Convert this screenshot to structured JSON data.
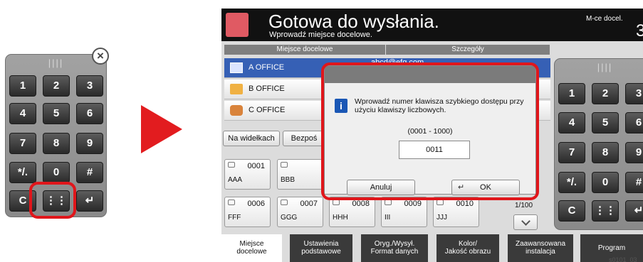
{
  "keypad": {
    "grip": "||||",
    "close_icon": "×",
    "keys": [
      "1",
      "2",
      "3",
      "4",
      "5",
      "6",
      "7",
      "8",
      "9",
      "*/.",
      "0",
      "#",
      "C",
      "⋮⋮",
      "↵"
    ]
  },
  "screen": {
    "title": "Gotowa do wysłania.",
    "subtitle": "Wprowadź miejsce docelowe.",
    "dest_label": "M-ce docel.",
    "count": "3",
    "columns": [
      "Miejsce docelowe",
      "Szczegóły"
    ],
    "rows": [
      {
        "name": "A OFFICE",
        "detail": "abcd@efg.com"
      },
      {
        "name": "B OFFICE",
        "detail": ""
      },
      {
        "name": "C OFFICE",
        "detail": ""
      }
    ],
    "buttons": {
      "hook": "Na widełkach",
      "direct": "Bezpoś"
    },
    "quick": [
      {
        "num": "0001",
        "name": "AAA"
      },
      {
        "num": "",
        "name": "BBB"
      },
      {
        "num": "0006",
        "name": "FFF"
      },
      {
        "num": "0007",
        "name": "GGG"
      },
      {
        "num": "0008",
        "name": "HHH"
      },
      {
        "num": "0009",
        "name": "III"
      },
      {
        "num": "0010",
        "name": "JJJ"
      }
    ],
    "page": "1/100",
    "tabs": [
      {
        "l1": "Miejsce",
        "l2": "docelowe"
      },
      {
        "l1": "Ustawienia",
        "l2": "podstawowe"
      },
      {
        "l1": "Oryg./Wysył.",
        "l2": "Format danych"
      },
      {
        "l1": "Kolor/",
        "l2": "Jakość obrazu"
      },
      {
        "l1": "Zaawansowana",
        "l2": "instalacja"
      },
      {
        "l1": "Program",
        "l2": ""
      }
    ],
    "dialog": {
      "message": "Wprowadź numer klawisza szybkiego dostępu przy użyciu klawiszy liczbowych.",
      "range": "(0001 - 1000)",
      "value": "0011",
      "cancel": "Anuluj",
      "ok": "OK"
    }
  },
  "caption": "s0101_03",
  "colors": {
    "accent_red": "#e0161b",
    "selected_row": "#3660b5"
  }
}
